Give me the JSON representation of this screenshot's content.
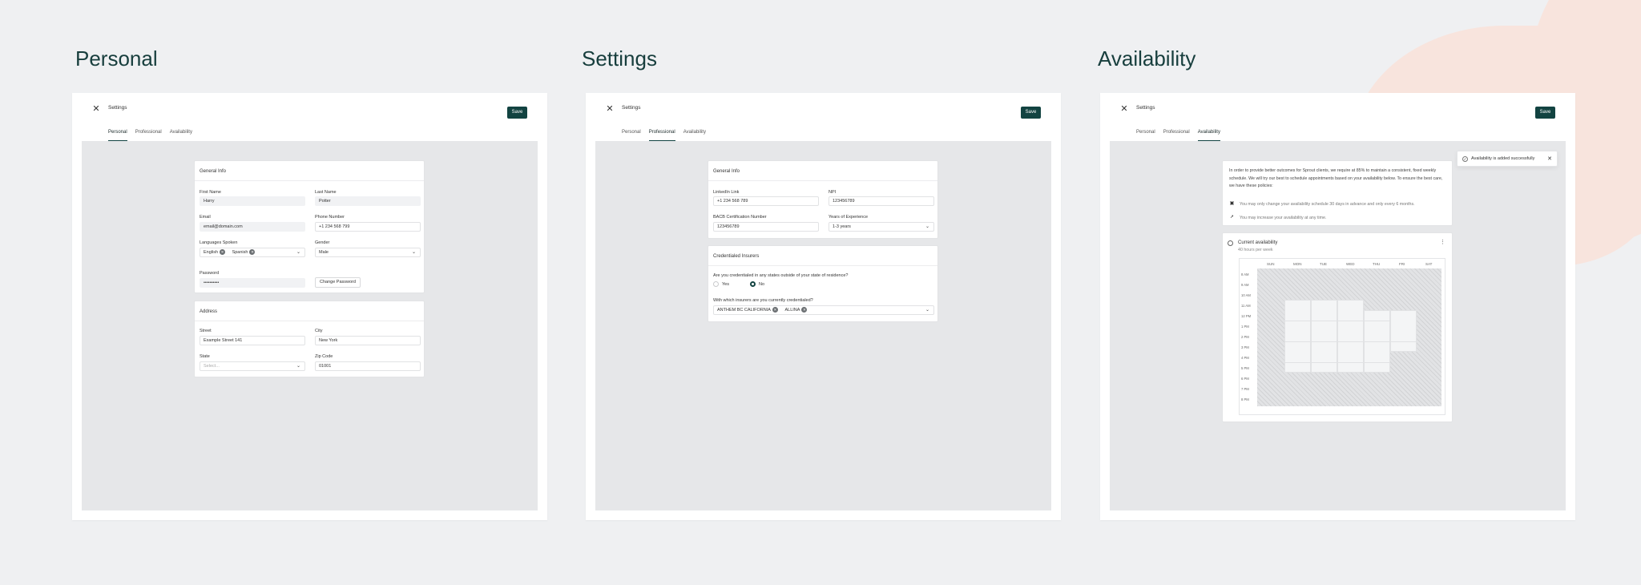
{
  "sections": {
    "personal_title": "Personal",
    "settings_title": "Settings",
    "availability_title": "Availability"
  },
  "topbar": {
    "title": "Settings",
    "save_label": "Save"
  },
  "tabs": [
    "Personal",
    "Professional",
    "Availability"
  ],
  "personal": {
    "general_title": "General Info",
    "first_name_label": "First Name",
    "first_name_value": "Harry",
    "last_name_label": "Last Name",
    "last_name_value": "Potter",
    "email_label": "Email",
    "email_value": "email@domain.com",
    "phone_label": "Phone Number",
    "phone_value": "+1 234 568 799",
    "languages_label": "Languages Spoken",
    "languages": [
      "English",
      "Spanish"
    ],
    "gender_label": "Gender",
    "gender_value": "Male",
    "password_label": "Password",
    "password_value": "••••••••••",
    "change_password_label": "Change Password",
    "address_title": "Address",
    "street_label": "Street",
    "street_value": "Example Street 141",
    "city_label": "City",
    "city_value": "New York",
    "state_label": "State",
    "state_placeholder": "Select...",
    "zip_label": "Zip Code",
    "zip_value": "01001"
  },
  "professional": {
    "general_title": "General Info",
    "linkedin_label": "LinkedIn Link",
    "linkedin_value": "+1 234 568 789",
    "npi_label": "NPI",
    "npi_value": "123456789",
    "bacb_label": "BACB Certification Number",
    "bacb_value": "123456789",
    "experience_label": "Years of Experience",
    "experience_value": "1-3 years",
    "insurers_title": "Credentialed Insurers",
    "question1": "Are you credentialed in any states outside of your state of residence?",
    "yes_label": "Yes",
    "no_label": "No",
    "question2": "With which insurers are you currently credentialed?",
    "insurers": [
      "ANTHEM BC CALIFORNIA",
      "ALLINA"
    ]
  },
  "availability": {
    "toast_text": "Availability is added successfully",
    "intro": "In order to provide better outcomes for Sprout clients, we require at 85% to maintain a consistent, fixed weekly schedule. We will try our best to schedule appointments based on your availability below. To ensure the best care, we have these policies:",
    "policy1": "You may only change your availability schedule 30 days in advance and only every 6 months.",
    "policy2": "You may increase your availability at any time.",
    "current_title": "Current availability",
    "current_sub": "40 hours per week",
    "days": [
      "SUN",
      "MON",
      "TUE",
      "WED",
      "THU",
      "FRI",
      "SAT"
    ],
    "times": [
      "8 AM",
      "9 AM",
      "10 AM",
      "11 AM",
      "12 PM",
      "1 PM",
      "2 PM",
      "3 PM",
      "4 PM",
      "5 PM",
      "6 PM",
      "7 PM",
      "8 PM"
    ]
  },
  "colors": {
    "brand": "#124341",
    "background": "#eff0f2",
    "accent_blob": "#f8e4dd"
  },
  "icons": [
    "close-icon",
    "chevron-down-icon",
    "calendar-icon",
    "arrow-icon",
    "kebab-icon",
    "check-circle-icon"
  ]
}
